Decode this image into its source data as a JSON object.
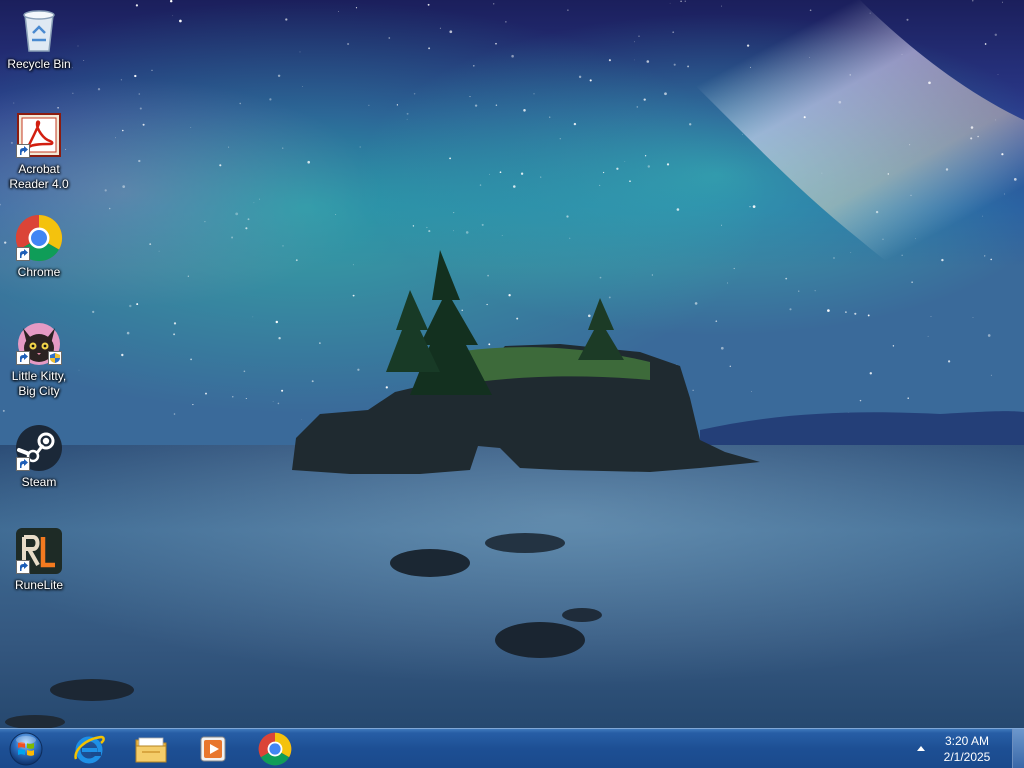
{
  "desktop_icons": [
    {
      "label": "Recycle Bin",
      "icon": "recycle-bin-icon"
    },
    {
      "label": "Acrobat Reader 4.0",
      "icon": "acrobat-reader-icon"
    },
    {
      "label": "Chrome",
      "icon": "chrome-icon"
    },
    {
      "label": "Little Kitty, Big City",
      "icon": "little-kitty-icon"
    },
    {
      "label": "Steam",
      "icon": "steam-icon"
    },
    {
      "label": "RuneLite",
      "icon": "runelite-icon"
    }
  ],
  "taskbar": {
    "pinned": [
      {
        "name": "Internet Explorer",
        "icon": "internet-explorer-icon"
      },
      {
        "name": "Windows Explorer",
        "icon": "folder-icon"
      },
      {
        "name": "Media Player",
        "icon": "media-player-icon"
      },
      {
        "name": "Google Chrome",
        "icon": "chrome-icon"
      }
    ],
    "clock": {
      "time": "3:20 AM",
      "date": "2/1/2025"
    }
  },
  "colors": {
    "taskbar": "#1d4f94",
    "chrome_red": "#db4437",
    "chrome_yellow": "#f4c20d",
    "chrome_green": "#0f9d58",
    "chrome_blue": "#4285f4",
    "steam_blue": "#1b2838"
  }
}
